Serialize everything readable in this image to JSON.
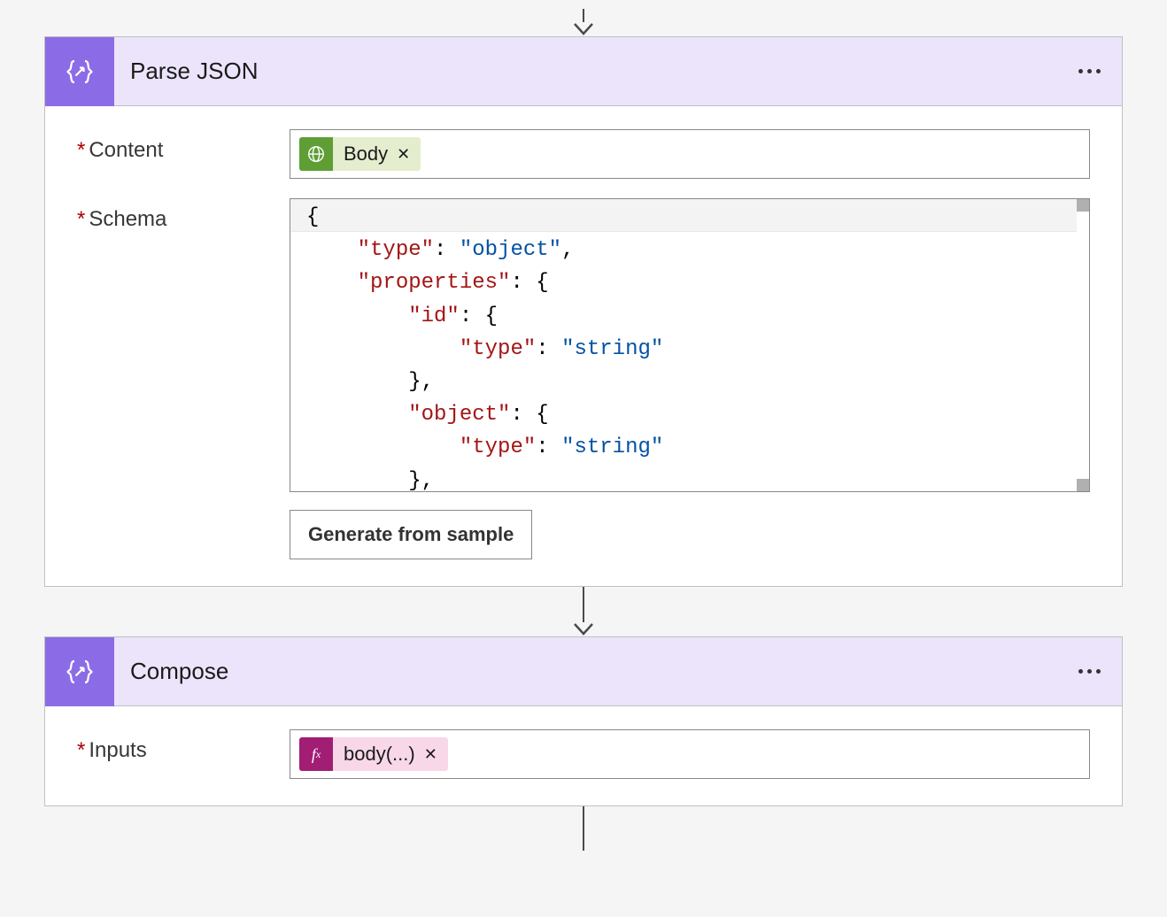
{
  "steps": {
    "parseJson": {
      "title": "Parse JSON",
      "fields": {
        "content": {
          "label": "Content",
          "required": true,
          "token": {
            "label": "Body",
            "iconType": "globe",
            "color": "green"
          }
        },
        "schema": {
          "label": "Schema",
          "required": true,
          "jsonLines": [
            {
              "indent": 0,
              "segments": [
                {
                  "t": "{",
                  "c": "punct"
                }
              ]
            },
            {
              "indent": 1,
              "segments": [
                {
                  "t": "\"type\"",
                  "c": "key"
                },
                {
                  "t": ": ",
                  "c": "punct"
                },
                {
                  "t": "\"object\"",
                  "c": "string"
                },
                {
                  "t": ",",
                  "c": "punct"
                }
              ]
            },
            {
              "indent": 1,
              "segments": [
                {
                  "t": "\"properties\"",
                  "c": "key"
                },
                {
                  "t": ": {",
                  "c": "punct"
                }
              ]
            },
            {
              "indent": 2,
              "segments": [
                {
                  "t": "\"id\"",
                  "c": "key"
                },
                {
                  "t": ": {",
                  "c": "punct"
                }
              ]
            },
            {
              "indent": 3,
              "segments": [
                {
                  "t": "\"type\"",
                  "c": "key"
                },
                {
                  "t": ": ",
                  "c": "punct"
                },
                {
                  "t": "\"string\"",
                  "c": "string"
                }
              ]
            },
            {
              "indent": 2,
              "segments": [
                {
                  "t": "},",
                  "c": "punct"
                }
              ]
            },
            {
              "indent": 2,
              "segments": [
                {
                  "t": "\"object\"",
                  "c": "key"
                },
                {
                  "t": ": {",
                  "c": "punct"
                }
              ]
            },
            {
              "indent": 3,
              "segments": [
                {
                  "t": "\"type\"",
                  "c": "key"
                },
                {
                  "t": ": ",
                  "c": "punct"
                },
                {
                  "t": "\"string\"",
                  "c": "string"
                }
              ]
            },
            {
              "indent": 2,
              "segments": [
                {
                  "t": "},",
                  "c": "punct"
                }
              ]
            }
          ],
          "buttonLabel": "Generate from sample"
        }
      }
    },
    "compose": {
      "title": "Compose",
      "fields": {
        "inputs": {
          "label": "Inputs",
          "required": true,
          "token": {
            "label": "body(...)",
            "iconType": "fx",
            "color": "pink"
          }
        }
      }
    }
  }
}
